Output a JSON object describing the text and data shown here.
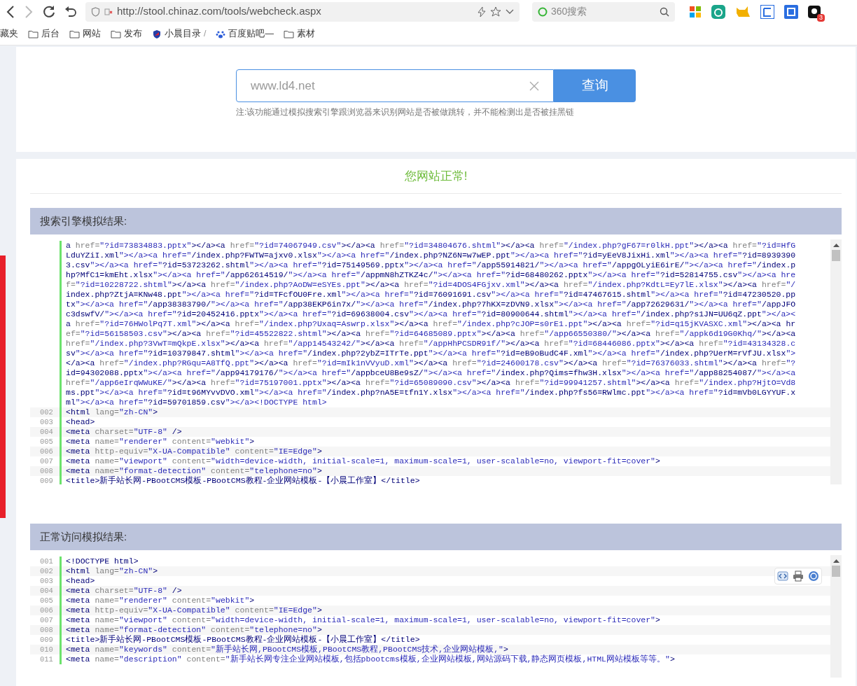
{
  "browser": {
    "url": "http://stool.chinaz.com/tools/webcheck.aspx",
    "search_placeholder": "360搜索",
    "badge": "3",
    "bookmarks": [
      {
        "kind": "text",
        "label": "藏夹"
      },
      {
        "kind": "folder",
        "label": "后台"
      },
      {
        "kind": "folder",
        "label": "网站"
      },
      {
        "kind": "folder",
        "label": "发布"
      },
      {
        "kind": "site",
        "label": "小晨目录"
      },
      {
        "kind": "separator",
        "label": "/"
      },
      {
        "kind": "paw",
        "label": "百度贴吧—"
      },
      {
        "kind": "folder",
        "label": "素材"
      }
    ]
  },
  "query": {
    "value": "www.ld4.net",
    "button": "查询",
    "note": "注:该功能通过模拟搜索引擎跟浏览器来识别网站是否被做跳转，并不能检测出是否被挂黑链"
  },
  "result_message": "您网站正常!",
  "sections": [
    {
      "title": "搜索引擎模拟结果:",
      "continued_rows": [
        "a href=\"?id=73834883.pptx\"></a><a href=\"?id=74067949.csv\"></a><a href=\"?id=34804676.shtml\"></a><a href=\"/index.php?gF67=r0lkH.ppt\"></a><a href=\"?id=HfG",
        "LduYZiI.xml\"></a><a href=\"/index.php?FWTW=ajxv0.xlsx\"></a><a href=\"/index.php?NZ6N=w7wEP.ppt\"></a><a href=\"?id=yEeV8JixHi.xml\"></a><a href=\"?id=8939390",
        "3.csv\"></a><a href=\"?id=53723262.shtml\"></a><a href=\"?id=75149569.pptx\"></a><a href=\"/app55914821/\"></a><a href=\"/appgOLyiE6irE/\"></a><a href=\"/index.p",
        "hp?MfC1=kmEht.xlsx\"></a><a href=\"/app62614519/\"></a><a href=\"/appmN8hZTKZ4c/\"></a><a href=\"?id=68480262.pptx\"></a><a href=\"?id=52814755.csv\"></a><a hre",
        "f=\"?id=10228722.shtml\"></a><a href=\"/index.php?AoDW=eSYEs.ppt\"></a><a href=\"?id=4DOS4FGjxv.xml\"></a><a href=\"/index.php?KdtL=Ey7lE.xlsx\"></a><a href=\"/",
        "index.php?ZtjA=KNw48.ppt\"></a><a href=\"?id=TFcfOU0Fre.xml\"></a><a href=\"?id=76091691.csv\"></a><a href=\"?id=47467615.shtml\"></a><a href=\"?id=47230520.pp",
        "tx\"></a><a href=\"/app38383790/\"></a><a href=\"/app38EKP6in7x/\"></a><a href=\"/index.php?7hKX=zDVN9.xlsx\"></a><a href=\"/app72629631/\"></a><a href=\"/appJFO",
        "c3dswfV/\"></a><a href=\"?id=20452416.pptx\"></a><a href=\"?id=69638004.csv\"></a><a href=\"?id=80900644.shtml\"></a><a href=\"/index.php?s1JN=UU6qZ.ppt\"></a><",
        "a href=\"?id=76HWolPq7T.xml\"></a><a href=\"/index.php?Uxaq=Aswrp.xlsx\"></a><a href=\"/index.php?cJOP=s0rE1.ppt\"></a><a href=\"?id=q15jKVASXC.xml\"></a><a hr",
        "ef=\"?id=56158503.csv\"></a><a href=\"?id=45522822.shtml\"></a><a href=\"?id=64685089.pptx\"></a><a href=\"/app66550380/\"></a><a href=\"/appk6d19G0Khq/\"></a><a",
        "href=\"/index.php?3VwT=mQkpE.xlsx\"></a><a href=\"/app14543242/\"></a><a href=\"/appHhPCSDR91f/\"></a><a href=\"?id=68446086.pptx\"></a><a href=\"?id=43134328.c",
        "sv\"></a><a href=\"?id=10379847.shtml\"></a><a href=\"/index.php?2ybZ=ITrTe.ppt\"></a><a href=\"?id=eB9oBudC4F.xml\"></a><a href=\"/index.php?UerM=rVfJU.xlsx\">",
        "</a><a href=\"/index.php?RGqu=A8TfQ.ppt\"></a><a href=\"?id=mIk1nVVyuD.xml\"></a><a href=\"?id=24600178.csv\"></a><a href=\"?id=76376033.shtml\"></a><a href=\"?",
        "id=94302088.pptx\"></a><a href=\"/app94179176/\"></a><a href=\"/appbceU8Be9sZ/\"></a><a href=\"/index.php?Qims=fhw3H.xlsx\"></a><a href=\"/app88254087/\"></a><a",
        "href=\"/app6eIrqWWuKE/\"></a><a href=\"?id=75197001.pptx\"></a><a href=\"?id=65089090.csv\"></a><a href=\"?id=99941257.shtml\"></a><a href=\"/index.php?HjtO=Vd8",
        "ms.ppt\"></a><a href=\"?id=t96MYvvDVO.xml\"></a><a href=\"/index.php?nA5E=tfn1Y.xlsx\"></a><a href=\"/index.php?fs56=RWlmc.ppt\"></a><a href=\"?id=mVb0LGYYUF.x",
        "ml\"></a><a href=\"?id=59701859.csv\"></a><!DOCTYPE html>"
      ],
      "lines": [
        {
          "number": "002",
          "text": "<html lang=\"zh-CN\">"
        },
        {
          "number": "003",
          "text": "<head>"
        },
        {
          "number": "004",
          "text": "<meta charset=\"UTF-8\" />"
        },
        {
          "number": "005",
          "text": "<meta name=\"renderer\" content=\"webkit\">"
        },
        {
          "number": "006",
          "text": "<meta http-equiv=\"X-UA-Compatible\" content=\"IE=Edge\">"
        },
        {
          "number": "007",
          "text": "<meta name=\"viewport\" content=\"width=device-width, initial-scale=1, maximum-scale=1, user-scalable=no, viewport-fit=cover\">"
        },
        {
          "number": "008",
          "text": "<meta name=\"format-detection\" content=\"telephone=no\">"
        },
        {
          "number": "009",
          "text": "<title>新手站长网-PBootCMS模板-PBootCMS教程-企业网站模板-【小晨工作室】</title>"
        }
      ]
    },
    {
      "title": "正常访问模拟结果:",
      "toolbar": true,
      "lines": [
        {
          "number": "001",
          "text": "<!DOCTYPE html>"
        },
        {
          "number": "002",
          "text": "<html lang=\"zh-CN\">"
        },
        {
          "number": "003",
          "text": "<head>"
        },
        {
          "number": "004",
          "text": "<meta charset=\"UTF-8\" />"
        },
        {
          "number": "005",
          "text": "<meta name=\"renderer\" content=\"webkit\">"
        },
        {
          "number": "006",
          "text": "<meta http-equiv=\"X-UA-Compatible\" content=\"IE=Edge\">"
        },
        {
          "number": "007",
          "text": "<meta name=\"viewport\" content=\"width=device-width, initial-scale=1, maximum-scale=1, user-scalable=no, viewport-fit=cover\">"
        },
        {
          "number": "008",
          "text": "<meta name=\"format-detection\" content=\"telephone=no\">"
        },
        {
          "number": "009",
          "text": "<title>新手站长网-PBootCMS模板-PBootCMS教程-企业网站模板-【小晨工作室】</title>"
        },
        {
          "number": "010",
          "text": "<meta name=\"keywords\" content=\"新手站长网,PBootCMS模板,PBootCMS教程,PBootCMS技术,企业网站模板,\">"
        },
        {
          "number": "011",
          "text": "<meta name=\"description\" content=\"新手站长网专注企业网站模板,包括pbootcms模板,企业网站模板,网站源码下载,静态网页模板,HTML网站模板等等。\">"
        }
      ]
    }
  ]
}
